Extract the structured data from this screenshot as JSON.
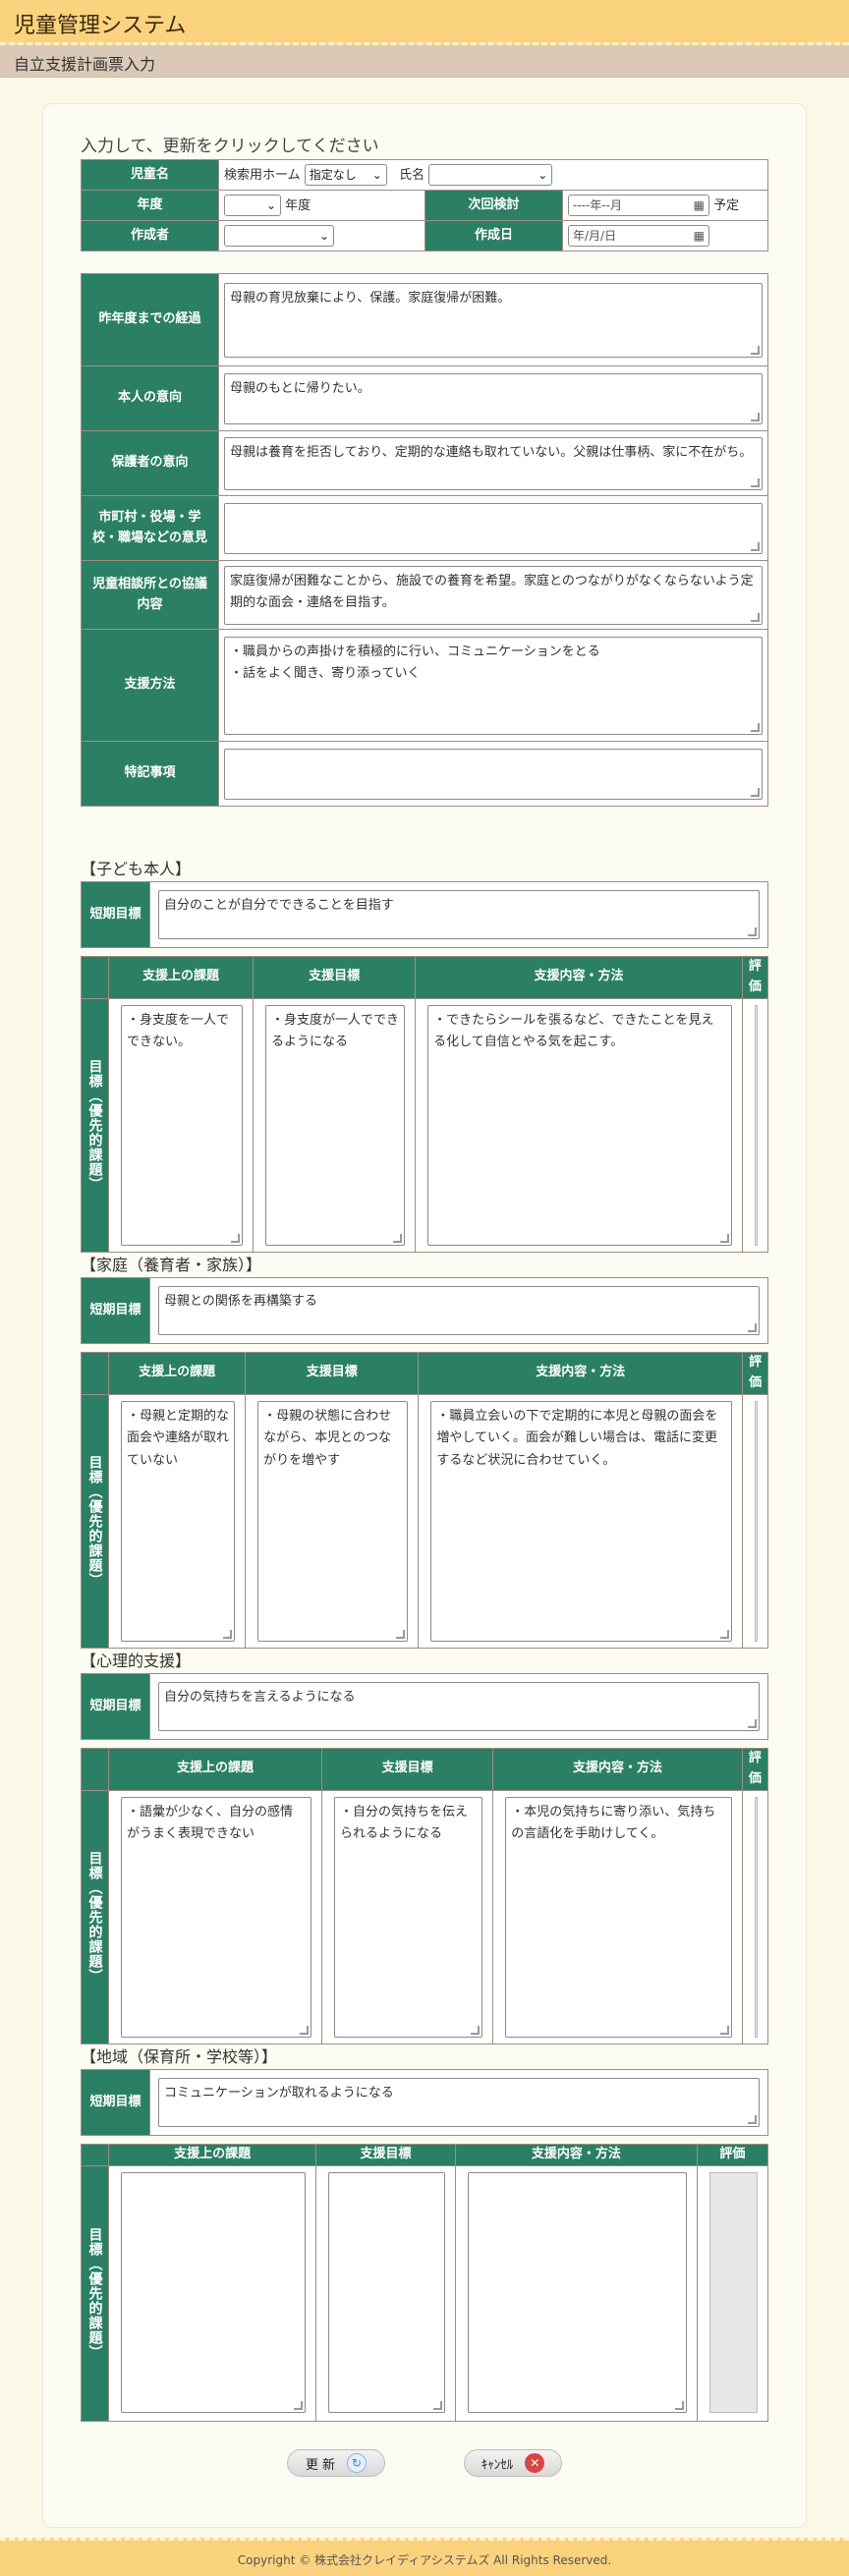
{
  "app": {
    "title": "児童管理システム",
    "subtitle": "自立支援計画票入力"
  },
  "instruction": "入力して、更新をクリックしてください",
  "basic": {
    "child_label": "児童名",
    "search_home_label": "検索用ホーム",
    "home_select_value": "指定なし",
    "name_label": "氏名",
    "name_select_value": "",
    "year_label": "年度",
    "year_select_value": "",
    "year_suffix": "年度",
    "next_review_label": "次回検討",
    "next_review_value": "----年--月",
    "next_review_suffix": "予定",
    "author_label": "作成者",
    "author_value": "",
    "created_label": "作成日",
    "created_value": "年/月/日"
  },
  "main_rows": [
    {
      "label": "昨年度までの経過",
      "value": "母親の育児放棄により、保護。家庭復帰が困難。"
    },
    {
      "label": "本人の意向",
      "value": "母親のもとに帰りたい。"
    },
    {
      "label": "保護者の意向",
      "value": "母親は養育を拒否しており、定期的な連絡も取れていない。父親は仕事柄、家に不在がち。"
    },
    {
      "label": "市町村・役場・学校・職場などの意見",
      "value": ""
    },
    {
      "label": "児童相談所との協議内容",
      "value": "家庭復帰が困難なことから、施設での養育を希望。家庭とのつながりがなくならないよう定期的な面会・連絡を目指す。"
    },
    {
      "label": "支援方法",
      "value": "・職員からの声掛けを積極的に行い、コミュニケーションをとる\n・話をよく聞き、寄り添っていく"
    },
    {
      "label": "特記事項",
      "value": ""
    }
  ],
  "grid_headers": {
    "short_term": "短期目標",
    "col1": "支援上の課題",
    "col2": "支援目標",
    "col3": "支援内容・方法",
    "col4": "評価",
    "vertical": "目標（優先的課題）"
  },
  "sections": [
    {
      "title": "【子ども本人】",
      "short_term": "自分のことが自分でできることを目指す",
      "issue": "・身支度を一人でできない。",
      "goal": "・身支度が一人でできるようになる",
      "method": "・できたらシールを張るなど、できたことを見える化して自信とやる気を起こす。"
    },
    {
      "title": "【家庭（養育者・家族）】",
      "short_term": "母親との関係を再構築する",
      "issue": "・母親と定期的な面会や連絡が取れていない",
      "goal": "・母親の状態に合わせながら、本児とのつながりを増やす",
      "method": "・職員立会いの下で定期的に本児と母親の面会を増やしていく。面会が難しい場合は、電話に変更するなど状況に合わせていく。"
    },
    {
      "title": "【心理的支援】",
      "short_term": "自分の気持ちを言えるようになる",
      "issue": "・語彙が少なく、自分の感情がうまく表現できない",
      "goal": "・自分の気持ちを伝えられるようになる",
      "method": "・本児の気持ちに寄り添い、気持ちの言語化を手助けしてく。"
    },
    {
      "title": "【地域（保育所・学校等）】",
      "short_term": "コミュニケーションが取れるようになる",
      "issue": "",
      "goal": "",
      "method": ""
    }
  ],
  "buttons": {
    "update": "更 新",
    "cancel": "ｷｬﾝｾﾙ"
  },
  "footer": "Copyright © 株式会社クレイディアシステムズ All Rights Reserved.",
  "colors": {
    "header": "#fbd27e",
    "accent": "#2b7f65",
    "subheader": "#dbc9b7"
  }
}
